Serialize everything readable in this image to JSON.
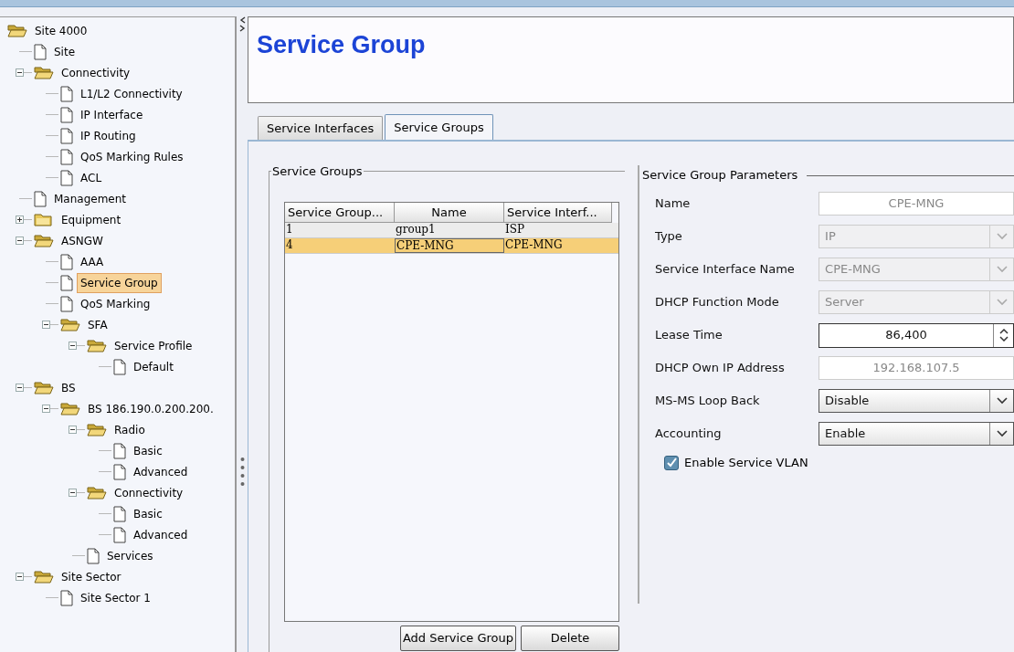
{
  "tree": [
    {
      "label": "Site 4000",
      "kind": "folder",
      "selected": false,
      "children": [
        {
          "label": "Site",
          "kind": "page",
          "selected": false
        },
        {
          "label": "Connectivity",
          "kind": "folder",
          "expanded": true,
          "selected": false,
          "children": [
            {
              "label": "L1/L2 Connectivity",
              "kind": "page",
              "selected": false
            },
            {
              "label": "IP Interface",
              "kind": "page",
              "selected": false
            },
            {
              "label": "IP Routing",
              "kind": "page",
              "selected": false
            },
            {
              "label": "QoS Marking Rules",
              "kind": "page",
              "selected": false
            },
            {
              "label": "ACL",
              "kind": "page",
              "selected": false
            }
          ]
        },
        {
          "label": "Management",
          "kind": "page",
          "selected": false
        },
        {
          "label": "Equipment",
          "kind": "folder",
          "expanded": false,
          "selected": false
        },
        {
          "label": "ASNGW",
          "kind": "folder",
          "expanded": true,
          "selected": false,
          "children": [
            {
              "label": "AAA",
              "kind": "page",
              "selected": false
            },
            {
              "label": "Service Group",
              "kind": "page",
              "selected": true
            },
            {
              "label": "QoS Marking",
              "kind": "page",
              "selected": false
            },
            {
              "label": "SFA",
              "kind": "folder",
              "expanded": true,
              "selected": false,
              "children": [
                {
                  "label": "Service Profile",
                  "kind": "folder",
                  "expanded": true,
                  "selected": false,
                  "children": [
                    {
                      "label": "Default",
                      "kind": "page",
                      "selected": false
                    }
                  ]
                }
              ]
            }
          ]
        },
        {
          "label": "BS",
          "kind": "folder",
          "expanded": true,
          "selected": false,
          "children": [
            {
              "label": "BS 186.190.0.200.200.",
              "kind": "folder",
              "expanded": true,
              "selected": false,
              "children": [
                {
                  "label": "Radio",
                  "kind": "folder",
                  "expanded": true,
                  "selected": false,
                  "children": [
                    {
                      "label": "Basic",
                      "kind": "page",
                      "selected": false
                    },
                    {
                      "label": "Advanced",
                      "kind": "page",
                      "selected": false
                    }
                  ]
                },
                {
                  "label": "Connectivity",
                  "kind": "folder",
                  "expanded": true,
                  "selected": false,
                  "children": [
                    {
                      "label": "Basic",
                      "kind": "page",
                      "selected": false
                    },
                    {
                      "label": "Advanced",
                      "kind": "page",
                      "selected": false
                    }
                  ]
                },
                {
                  "label": "Services",
                  "kind": "page",
                  "selected": false
                }
              ]
            }
          ]
        },
        {
          "label": "Site Sector",
          "kind": "folder",
          "expanded": true,
          "selected": false,
          "children": [
            {
              "label": "Site Sector 1",
              "kind": "page",
              "selected": false
            }
          ]
        }
      ]
    }
  ],
  "page_title": "Service Group",
  "tabs": [
    {
      "label": "Service Interfaces",
      "selected": false
    },
    {
      "label": "Service Groups",
      "selected": true
    }
  ],
  "groups_panel": {
    "title": "Service Groups",
    "table": {
      "columns": [
        "Service Group...",
        "Name",
        "Service Interf..."
      ],
      "rows": [
        {
          "cells": [
            "1",
            "group1",
            "ISP"
          ],
          "selected": false
        },
        {
          "cells": [
            "4",
            "CPE-MNG",
            "CPE-MNG"
          ],
          "selected": true
        }
      ]
    },
    "buttons": [
      "Add Service Group",
      "Delete"
    ]
  },
  "parameters": {
    "title": "Service Group Parameters",
    "fields": [
      {
        "label": "Name",
        "kind": "text",
        "value": "CPE-MNG",
        "disabled": true
      },
      {
        "label": "Type",
        "kind": "select",
        "value": "IP",
        "disabled": true
      },
      {
        "label": "Service Interface Name",
        "kind": "select",
        "value": "CPE-MNG",
        "disabled": true
      },
      {
        "label": "DHCP Function Mode",
        "kind": "select",
        "value": "Server",
        "disabled": true
      },
      {
        "label": "Lease Time",
        "kind": "spinner",
        "value": "86,400",
        "disabled": false
      },
      {
        "label": "DHCP Own IP Address",
        "kind": "text",
        "value": "192.168.107.5",
        "disabled": true
      },
      {
        "label": "MS-MS Loop Back",
        "kind": "select",
        "value": "Disable",
        "disabled": false
      },
      {
        "label": "Accounting",
        "kind": "select",
        "value": "Enable",
        "disabled": false
      }
    ],
    "checkbox": {
      "label": "Enable Service VLAN",
      "checked": true
    }
  }
}
